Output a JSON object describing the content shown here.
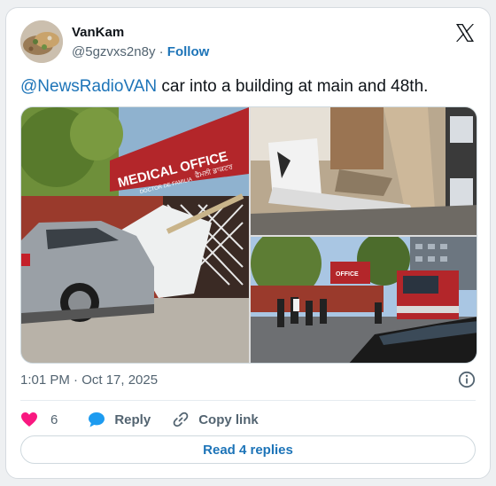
{
  "author": {
    "display_name": "VanKam",
    "handle": "@5gzvxs2n8y",
    "separator": "·",
    "follow_label": "Follow",
    "avatar_icon": "avatar-photo"
  },
  "platform_icon": "x-logo-icon",
  "tweet": {
    "mention": "@NewsRadioVAN",
    "body": " car into a building at main and 48th."
  },
  "media": {
    "photos": [
      {
        "scene": "suv-crashed-into-medical-office",
        "sign_text": "MEDICAL OFFICE",
        "sign_subtext": "DOCTOR DE FAMILIA",
        "sign_punjabi": "ਫੈਮਲੀ ਡਾਕਟਰ"
      },
      {
        "scene": "interior-debris"
      },
      {
        "scene": "street-with-fire-truck",
        "sign_text": "OFFICE"
      }
    ]
  },
  "timestamp": "1:01 PM · Oct 17, 2025",
  "actions": {
    "like_count": "6",
    "reply_label": "Reply",
    "copy_link_label": "Copy link"
  },
  "read_replies_label": "Read 4 replies",
  "colors": {
    "link": "#1d74b8",
    "heart": "#f91880",
    "reply_bubble": "#1d9bf0",
    "muted": "#536471"
  }
}
